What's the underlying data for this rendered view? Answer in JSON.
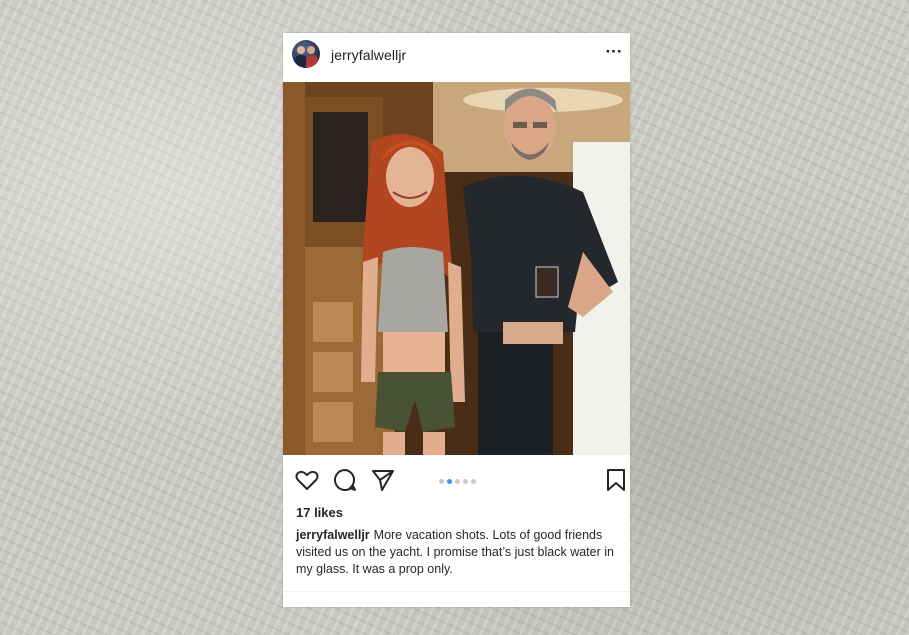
{
  "post": {
    "username": "jerryfalwelljr",
    "more_label": "···",
    "likes": "17 likes",
    "caption_user": "jerryfalwelljr",
    "caption_text": "More vacation shots.  Lots of good friends visited us on the yacht.  I promise that’s just black water in my glass.  It was a prop only.",
    "carousel": {
      "count": 5,
      "active_index": 1
    }
  },
  "icons": {
    "like": "heart-icon",
    "comment": "comment-bubble-icon",
    "share": "send-paper-plane-icon",
    "save": "bookmark-icon",
    "more": "ellipsis-icon"
  },
  "colors": {
    "accent_dot": "#3897f0",
    "inactive_dot": "#c8c8c8",
    "text": "#262626",
    "card_bg": "#ffffff"
  }
}
